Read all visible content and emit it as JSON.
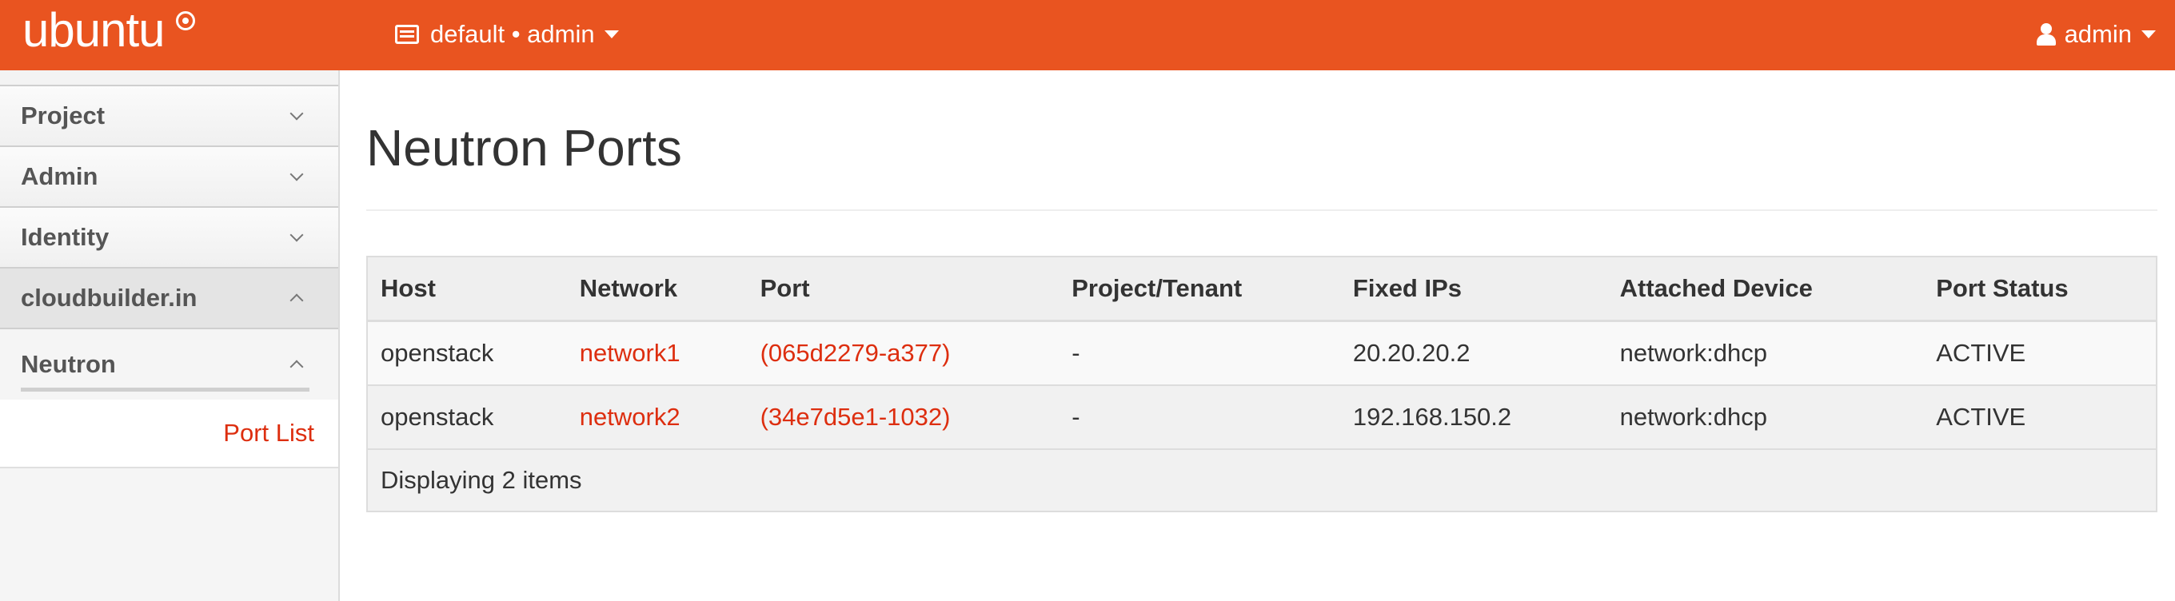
{
  "header": {
    "brand": "ubuntu",
    "context": "default • admin",
    "user": "admin"
  },
  "sidebar": {
    "items": [
      {
        "label": "Project"
      },
      {
        "label": "Admin"
      },
      {
        "label": "Identity"
      },
      {
        "label": "cloudbuilder.in"
      }
    ],
    "sub_item": {
      "label": "Neutron"
    },
    "leaf": {
      "label": "Port List"
    }
  },
  "main": {
    "title": "Neutron Ports",
    "columns": [
      "Host",
      "Network",
      "Port",
      "Project/Tenant",
      "Fixed IPs",
      "Attached Device",
      "Port Status"
    ],
    "rows": [
      {
        "host": "openstack",
        "network": "network1",
        "port": "(065d2279-a377)",
        "tenant": "-",
        "fixed_ips": "20.20.20.2",
        "device": "network:dhcp",
        "status": "ACTIVE"
      },
      {
        "host": "openstack",
        "network": "network2",
        "port": "(34e7d5e1-1032)",
        "tenant": "-",
        "fixed_ips": "192.168.150.2",
        "device": "network:dhcp",
        "status": "ACTIVE"
      }
    ],
    "footer": "Displaying 2 items"
  },
  "colors": {
    "accent": "#e95420",
    "link": "#dd2e0f"
  }
}
